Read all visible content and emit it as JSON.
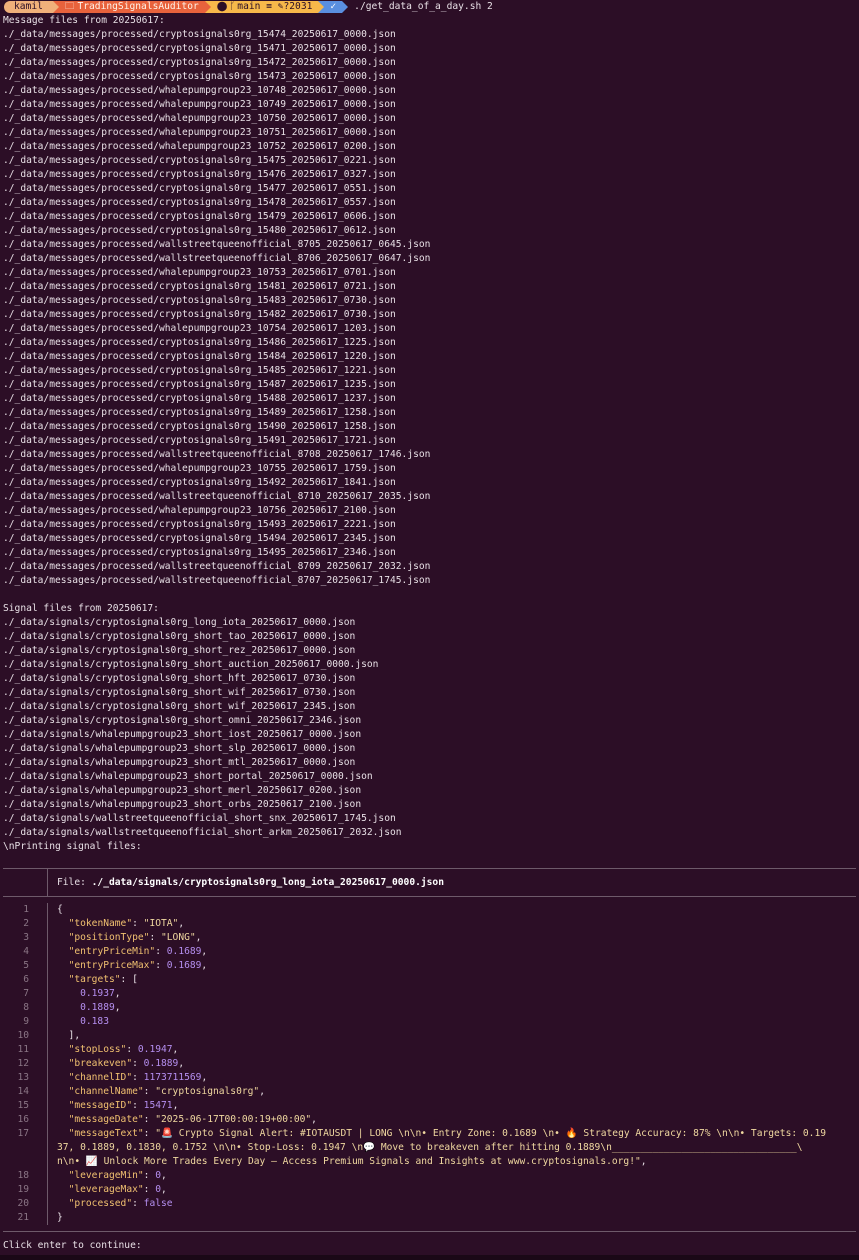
{
  "prompt": {
    "user": "kamil",
    "dir": "TradingSignalsAuditor",
    "branch": "main ≡ ✎?2031",
    "ok": "✓",
    "command": "./get_data_of_a_day.sh 2"
  },
  "messages_header": "Message files from 20250617:",
  "message_files": [
    "./_data/messages/processed/cryptosignals0rg_15474_20250617_0000.json",
    "./_data/messages/processed/cryptosignals0rg_15471_20250617_0000.json",
    "./_data/messages/processed/cryptosignals0rg_15472_20250617_0000.json",
    "./_data/messages/processed/cryptosignals0rg_15473_20250617_0000.json",
    "./_data/messages/processed/whalepumpgroup23_10748_20250617_0000.json",
    "./_data/messages/processed/whalepumpgroup23_10749_20250617_0000.json",
    "./_data/messages/processed/whalepumpgroup23_10750_20250617_0000.json",
    "./_data/messages/processed/whalepumpgroup23_10751_20250617_0000.json",
    "./_data/messages/processed/whalepumpgroup23_10752_20250617_0200.json",
    "./_data/messages/processed/cryptosignals0rg_15475_20250617_0221.json",
    "./_data/messages/processed/cryptosignals0rg_15476_20250617_0327.json",
    "./_data/messages/processed/cryptosignals0rg_15477_20250617_0551.json",
    "./_data/messages/processed/cryptosignals0rg_15478_20250617_0557.json",
    "./_data/messages/processed/cryptosignals0rg_15479_20250617_0606.json",
    "./_data/messages/processed/cryptosignals0rg_15480_20250617_0612.json",
    "./_data/messages/processed/wallstreetqueenofficial_8705_20250617_0645.json",
    "./_data/messages/processed/wallstreetqueenofficial_8706_20250617_0647.json",
    "./_data/messages/processed/whalepumpgroup23_10753_20250617_0701.json",
    "./_data/messages/processed/cryptosignals0rg_15481_20250617_0721.json",
    "./_data/messages/processed/cryptosignals0rg_15483_20250617_0730.json",
    "./_data/messages/processed/cryptosignals0rg_15482_20250617_0730.json",
    "./_data/messages/processed/whalepumpgroup23_10754_20250617_1203.json",
    "./_data/messages/processed/cryptosignals0rg_15486_20250617_1225.json",
    "./_data/messages/processed/cryptosignals0rg_15484_20250617_1220.json",
    "./_data/messages/processed/cryptosignals0rg_15485_20250617_1221.json",
    "./_data/messages/processed/cryptosignals0rg_15487_20250617_1235.json",
    "./_data/messages/processed/cryptosignals0rg_15488_20250617_1237.json",
    "./_data/messages/processed/cryptosignals0rg_15489_20250617_1258.json",
    "./_data/messages/processed/cryptosignals0rg_15490_20250617_1258.json",
    "./_data/messages/processed/cryptosignals0rg_15491_20250617_1721.json",
    "./_data/messages/processed/wallstreetqueenofficial_8708_20250617_1746.json",
    "./_data/messages/processed/whalepumpgroup23_10755_20250617_1759.json",
    "./_data/messages/processed/cryptosignals0rg_15492_20250617_1841.json",
    "./_data/messages/processed/wallstreetqueenofficial_8710_20250617_2035.json",
    "./_data/messages/processed/whalepumpgroup23_10756_20250617_2100.json",
    "./_data/messages/processed/cryptosignals0rg_15493_20250617_2221.json",
    "./_data/messages/processed/cryptosignals0rg_15494_20250617_2345.json",
    "./_data/messages/processed/cryptosignals0rg_15495_20250617_2346.json",
    "./_data/messages/processed/wallstreetqueenofficial_8709_20250617_2032.json",
    "./_data/messages/processed/wallstreetqueenofficial_8707_20250617_1745.json"
  ],
  "signals_header": "Signal files from 20250617:",
  "signal_files": [
    "./_data/signals/cryptosignals0rg_long_iota_20250617_0000.json",
    "./_data/signals/cryptosignals0rg_short_tao_20250617_0000.json",
    "./_data/signals/cryptosignals0rg_short_rez_20250617_0000.json",
    "./_data/signals/cryptosignals0rg_short_auction_20250617_0000.json",
    "./_data/signals/cryptosignals0rg_short_hft_20250617_0730.json",
    "./_data/signals/cryptosignals0rg_short_wif_20250617_0730.json",
    "./_data/signals/cryptosignals0rg_short_wif_20250617_2345.json",
    "./_data/signals/cryptosignals0rg_short_omni_20250617_2346.json",
    "./_data/signals/whalepumpgroup23_short_iost_20250617_0000.json",
    "./_data/signals/whalepumpgroup23_short_slp_20250617_0000.json",
    "./_data/signals/whalepumpgroup23_short_mtl_20250617_0000.json",
    "./_data/signals/whalepumpgroup23_short_portal_20250617_0000.json",
    "./_data/signals/whalepumpgroup23_short_merl_20250617_0200.json",
    "./_data/signals/whalepumpgroup23_short_orbs_20250617_2100.json",
    "./_data/signals/wallstreetqueenofficial_short_snx_20250617_1745.json",
    "./_data/signals/wallstreetqueenofficial_short_arkm_20250617_2032.json"
  ],
  "printing_line": "\\nPrinting signal files:",
  "bat": {
    "file_label": "File: ",
    "file_name": "./_data/signals/cryptosignals0rg_long_iota_20250617_0000.json",
    "line_numbers": [
      "1",
      "2",
      "3",
      "4",
      "5",
      "6",
      "7",
      "8",
      "9",
      "10",
      "11",
      "12",
      "13",
      "14",
      "15",
      "16",
      "17",
      "",
      "",
      "18",
      "19",
      "20",
      "21"
    ],
    "code_lines": [
      [
        {
          "t": "{",
          "c": "punct"
        }
      ],
      [
        {
          "t": "  ",
          "c": "punct"
        },
        {
          "t": "\"tokenName\"",
          "c": "key"
        },
        {
          "t": ": ",
          "c": "punct"
        },
        {
          "t": "\"IOTA\"",
          "c": "str"
        },
        {
          "t": ",",
          "c": "punct"
        }
      ],
      [
        {
          "t": "  ",
          "c": "punct"
        },
        {
          "t": "\"positionType\"",
          "c": "key"
        },
        {
          "t": ": ",
          "c": "punct"
        },
        {
          "t": "\"LONG\"",
          "c": "str"
        },
        {
          "t": ",",
          "c": "punct"
        }
      ],
      [
        {
          "t": "  ",
          "c": "punct"
        },
        {
          "t": "\"entryPriceMin\"",
          "c": "key"
        },
        {
          "t": ": ",
          "c": "punct"
        },
        {
          "t": "0.1689",
          "c": "num"
        },
        {
          "t": ",",
          "c": "punct"
        }
      ],
      [
        {
          "t": "  ",
          "c": "punct"
        },
        {
          "t": "\"entryPriceMax\"",
          "c": "key"
        },
        {
          "t": ": ",
          "c": "punct"
        },
        {
          "t": "0.1689",
          "c": "num"
        },
        {
          "t": ",",
          "c": "punct"
        }
      ],
      [
        {
          "t": "  ",
          "c": "punct"
        },
        {
          "t": "\"targets\"",
          "c": "key"
        },
        {
          "t": ": [",
          "c": "punct"
        }
      ],
      [
        {
          "t": "    ",
          "c": "punct"
        },
        {
          "t": "0.1937",
          "c": "num"
        },
        {
          "t": ",",
          "c": "punct"
        }
      ],
      [
        {
          "t": "    ",
          "c": "punct"
        },
        {
          "t": "0.1889",
          "c": "num"
        },
        {
          "t": ",",
          "c": "punct"
        }
      ],
      [
        {
          "t": "    ",
          "c": "punct"
        },
        {
          "t": "0.183",
          "c": "num"
        }
      ],
      [
        {
          "t": "  ],",
          "c": "punct"
        }
      ],
      [
        {
          "t": "  ",
          "c": "punct"
        },
        {
          "t": "\"stopLoss\"",
          "c": "key"
        },
        {
          "t": ": ",
          "c": "punct"
        },
        {
          "t": "0.1947",
          "c": "num"
        },
        {
          "t": ",",
          "c": "punct"
        }
      ],
      [
        {
          "t": "  ",
          "c": "punct"
        },
        {
          "t": "\"breakeven\"",
          "c": "key"
        },
        {
          "t": ": ",
          "c": "punct"
        },
        {
          "t": "0.1889",
          "c": "num"
        },
        {
          "t": ",",
          "c": "punct"
        }
      ],
      [
        {
          "t": "  ",
          "c": "punct"
        },
        {
          "t": "\"channelID\"",
          "c": "key"
        },
        {
          "t": ": ",
          "c": "punct"
        },
        {
          "t": "1173711569",
          "c": "num"
        },
        {
          "t": ",",
          "c": "punct"
        }
      ],
      [
        {
          "t": "  ",
          "c": "punct"
        },
        {
          "t": "\"channelName\"",
          "c": "key"
        },
        {
          "t": ": ",
          "c": "punct"
        },
        {
          "t": "\"cryptosignals0rg\"",
          "c": "str"
        },
        {
          "t": ",",
          "c": "punct"
        }
      ],
      [
        {
          "t": "  ",
          "c": "punct"
        },
        {
          "t": "\"messageID\"",
          "c": "key"
        },
        {
          "t": ": ",
          "c": "punct"
        },
        {
          "t": "15471",
          "c": "num"
        },
        {
          "t": ",",
          "c": "punct"
        }
      ],
      [
        {
          "t": "  ",
          "c": "punct"
        },
        {
          "t": "\"messageDate\"",
          "c": "key"
        },
        {
          "t": ": ",
          "c": "punct"
        },
        {
          "t": "\"2025-06-17T00:00:19+00:00\"",
          "c": "str"
        },
        {
          "t": ",",
          "c": "punct"
        }
      ],
      [
        {
          "t": "  ",
          "c": "punct"
        },
        {
          "t": "\"messageText\"",
          "c": "key"
        },
        {
          "t": ": ",
          "c": "punct"
        },
        {
          "t": "\"🚨 Crypto Signal Alert: #IOTAUSDT | LONG \\n\\n• Entry Zone: 0.1689 \\n• 🔥 Strategy Accuracy: 87% \\n\\n• Targets: 0.19",
          "c": "str"
        }
      ],
      [
        {
          "t": "37, 0.1889, 0.1830, 0.1752 \\n\\n• Stop-Loss: 0.1947 \\n💬 Move to breakeven after hitting 0.1889\\n________________________________\\",
          "c": "str"
        }
      ],
      [
        {
          "t": "n\\n• 📈 Unlock More Trades Every Day – Access Premium Signals and Insights at www.cryptosignals.org!\"",
          "c": "str"
        },
        {
          "t": ",",
          "c": "punct"
        }
      ],
      [
        {
          "t": "  ",
          "c": "punct"
        },
        {
          "t": "\"leverageMin\"",
          "c": "key"
        },
        {
          "t": ": ",
          "c": "punct"
        },
        {
          "t": "0",
          "c": "num"
        },
        {
          "t": ",",
          "c": "punct"
        }
      ],
      [
        {
          "t": "  ",
          "c": "punct"
        },
        {
          "t": "\"leverageMax\"",
          "c": "key"
        },
        {
          "t": ": ",
          "c": "punct"
        },
        {
          "t": "0",
          "c": "num"
        },
        {
          "t": ",",
          "c": "punct"
        }
      ],
      [
        {
          "t": "  ",
          "c": "punct"
        },
        {
          "t": "\"processed\"",
          "c": "key"
        },
        {
          "t": ": ",
          "c": "punct"
        },
        {
          "t": "false",
          "c": "bool"
        }
      ],
      [
        {
          "t": "}",
          "c": "punct"
        }
      ]
    ]
  },
  "final_prompt": "Click enter to continue:",
  "colors": {
    "background": "#2c0e26",
    "seg_user": "#f0b07a",
    "seg_dir": "#e8623c",
    "seg_git": "#f7b84a",
    "seg_ok": "#5a8fe0"
  }
}
